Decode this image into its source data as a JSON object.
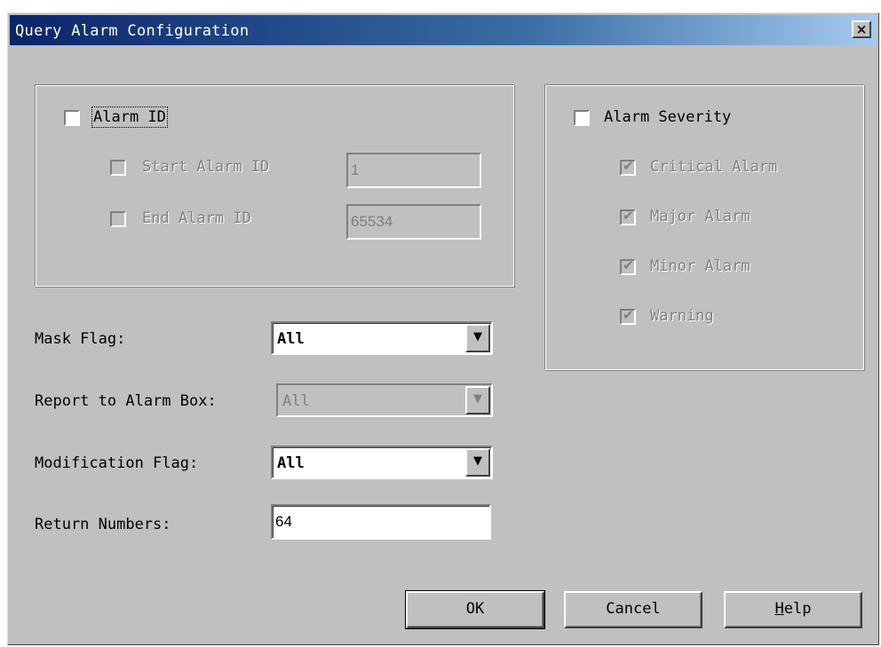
{
  "dialog": {
    "title": "Query Alarm Configuration",
    "close_icon": "×"
  },
  "alarm_id_group": {
    "label": "Alarm ID",
    "checked": false,
    "start_label": "Start Alarm ID",
    "start_value": "1",
    "end_label": "End Alarm ID",
    "end_value": "65534"
  },
  "severity_group": {
    "label": "Alarm Severity",
    "checked": false,
    "items": [
      {
        "label": "Critical Alarm",
        "checked": true,
        "enabled": false
      },
      {
        "label": "Major Alarm",
        "checked": true,
        "enabled": false
      },
      {
        "label": "Minor Alarm",
        "checked": true,
        "enabled": false
      },
      {
        "label": "Warning",
        "checked": true,
        "enabled": false
      }
    ]
  },
  "fields": {
    "mask_flag_label": "Mask Flag:",
    "mask_flag_value": "All",
    "report_label": "Report to Alarm Box:",
    "report_value": "All",
    "modification_label": "Modification Flag:",
    "modification_value": "All",
    "return_label": "Return Numbers:",
    "return_value": "64"
  },
  "buttons": {
    "ok": "OK",
    "cancel": "Cancel",
    "help_accel": "H",
    "help_rest": "elp"
  },
  "icons": {
    "checkmark": "✔",
    "dropdown_arrow": "▼"
  }
}
